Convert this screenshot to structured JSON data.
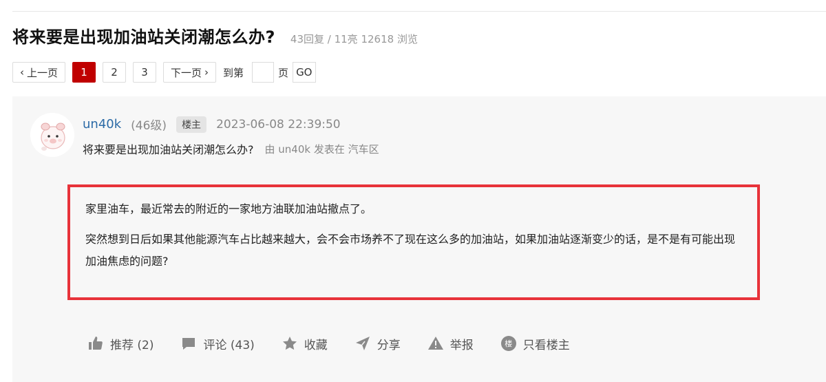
{
  "thread": {
    "title": "将来要是出现加油站关闭潮怎么办?",
    "stats": "43回复 / 11亮 12618 浏览"
  },
  "pagination": {
    "prev": "上一页",
    "pages": [
      "1",
      "2",
      "3"
    ],
    "current": "1",
    "next": "下一页",
    "jump_prefix": "到第",
    "jump_suffix": "页",
    "go": "GO"
  },
  "post": {
    "username": "un40k",
    "level": "(46级)",
    "badge": "楼主",
    "time": "2023-06-08 22:39:50",
    "subject": "将来要是出现加油站关闭潮怎么办?",
    "posted_by": "由 un40k 发表在 汽车区",
    "paragraphs": [
      "家里油车，最近常去的附近的一家地方油联加油站撤点了。",
      "突然想到日后如果其他能源汽车占比越来越大，会不会市场养不了现在这么多的加油站，如果加油站逐渐变少的话，是不是有可能出现加油焦虑的问题?"
    ],
    "highlight_color": "#e8333a"
  },
  "actions": {
    "recommend": "推荐 (2)",
    "comment": "评论 (43)",
    "favorite": "收藏",
    "share": "分享",
    "report": "举报",
    "only_op_icon_text": "楼",
    "only_op": "只看楼主"
  }
}
